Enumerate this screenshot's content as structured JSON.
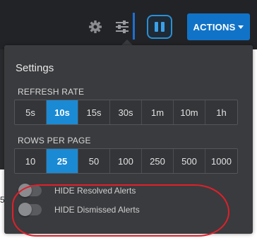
{
  "toolbar": {
    "icons": [
      "gear-icon",
      "sliders-icon",
      "pause-icon"
    ],
    "actions_label": "ACTIONS",
    "accent": "#1173c7"
  },
  "background": {
    "partial_text": "5"
  },
  "settings": {
    "title": "Settings",
    "refresh_rate": {
      "label": "REFRESH RATE",
      "options": [
        "5s",
        "10s",
        "15s",
        "30s",
        "1m",
        "10m",
        "1h"
      ],
      "selected": "10s"
    },
    "rows_per_page": {
      "label": "ROWS PER PAGE",
      "options": [
        "10",
        "25",
        "50",
        "100",
        "250",
        "500",
        "1000"
      ],
      "selected": "25"
    },
    "toggles": [
      {
        "label": "HIDE Resolved Alerts",
        "on": false
      },
      {
        "label": "HIDE Dismissed Alerts",
        "on": false
      }
    ],
    "active_color": "#1a8ad4"
  },
  "annotation": {
    "color": "#e0202a"
  }
}
